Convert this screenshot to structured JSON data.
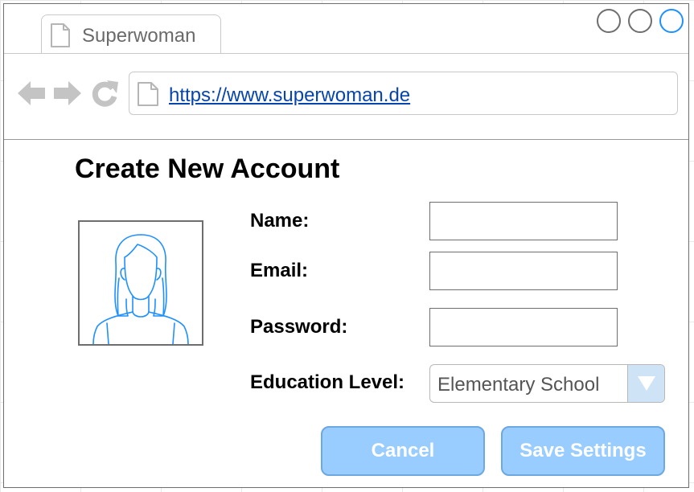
{
  "browser": {
    "tab_title": "Superwoman",
    "url": "https://www.superwoman.de"
  },
  "icons": {
    "tab": "document-icon",
    "back": "back-arrow-icon",
    "forward": "forward-arrow-icon",
    "reload": "reload-icon",
    "address": "document-icon",
    "avatar": "woman-avatar-icon",
    "dropdown": "triangle-down-icon"
  },
  "colors": {
    "accent": "#99ccff",
    "close_button": "#1e90ff",
    "link": "#0645ad",
    "avatar_stroke": "#1e90ff"
  },
  "form": {
    "title": "Create New Account",
    "name_label": "Name:",
    "name_value": "",
    "email_label": "Email:",
    "email_value": "",
    "password_label": "Password:",
    "password_value": "",
    "education_label": "Education Level:",
    "education_value": "Elementary School"
  },
  "buttons": {
    "cancel": "Cancel",
    "save": "Save Settings"
  }
}
